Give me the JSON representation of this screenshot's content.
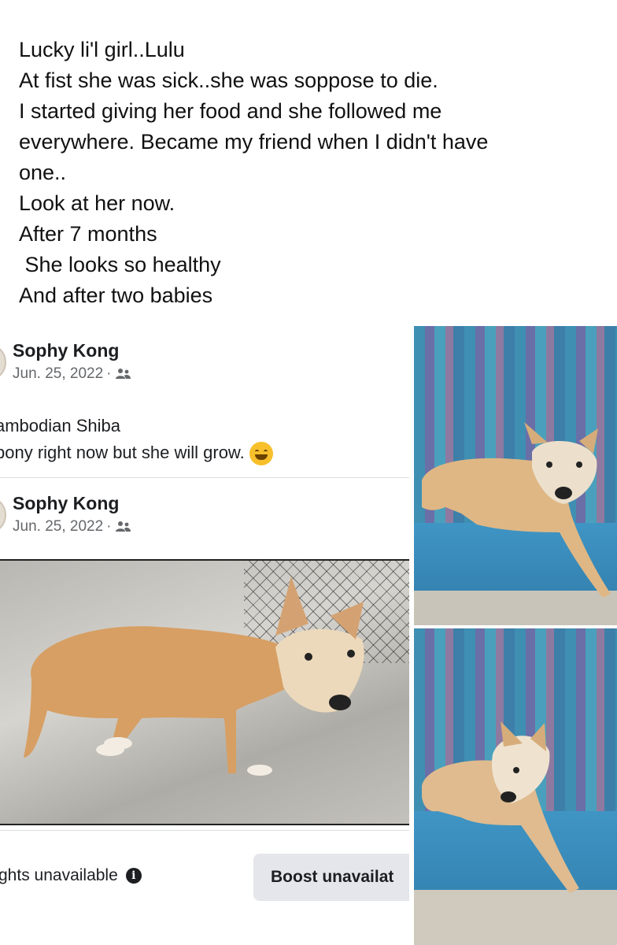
{
  "caption": {
    "lines": [
      "Lucky li'l girl..Lulu",
      "At fist she was sick..she was soppose to die.",
      "I started giving her food and she followed me",
      "everywhere. Became my friend when I didn't have",
      "one..",
      "Look at her now.",
      "After 7 months",
      " She looks so healthy",
      "And after two babies"
    ]
  },
  "fb_post": {
    "first_header": {
      "author": "Sophy Kong",
      "date": "Jun. 25, 2022",
      "separator": "·",
      "audience_icon": "friends-icon"
    },
    "post_text_lines": [
      "ambodian Shiba",
      "bony right now but she will grow."
    ],
    "emoji": "grinning-sweat-emoji",
    "shared_header": {
      "author": "Sophy Kong",
      "date": "Jun. 25, 2022",
      "separator": "·",
      "audience_icon": "friends-icon"
    },
    "insights_label": "ghts unavailable",
    "info_icon": "i",
    "boost_label": "Boost unavailat"
  },
  "photos": {
    "main": "dog-photo",
    "side_top": "dog-photo",
    "side_bottom": "dog-photo"
  },
  "colors": {
    "text": "#1c1e21",
    "meta": "#65676b",
    "button_bg": "#e4e6eb",
    "dog_fur": "#d9a46b"
  }
}
